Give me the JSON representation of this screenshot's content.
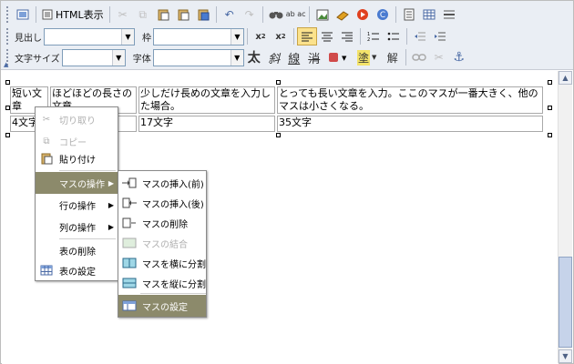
{
  "toolbar": {
    "row1": {
      "html_view_label": "HTML表示",
      "image_label": "ab ac"
    },
    "row2": {
      "heading_label": "見出し",
      "heading_value": "",
      "frame_label": "枠",
      "frame_value": ""
    },
    "row3": {
      "font_size_label": "文字サイズ",
      "font_size_value": "",
      "font_face_label": "字体",
      "font_face_value": "",
      "bold_label": "太",
      "italic_label": "斜",
      "underline_label": "線",
      "strike_label": "消",
      "highlight_label": "塗",
      "clear_label": "解"
    }
  },
  "table": {
    "rows": [
      [
        "短い文章",
        "ほどほどの長さの文章",
        "少しだけ長めの文章を入力した場合。",
        "とっても長い文章を入力。ここのマスが一番大きく、他のマスは小さくなる。"
      ],
      [
        "4文字",
        "",
        "17文字",
        "35文字"
      ]
    ]
  },
  "context_menu": {
    "cut": "切り取り",
    "copy": "コピー",
    "paste": "貼り付け",
    "cell_ops": "マスの操作",
    "row_ops": "行の操作",
    "col_ops": "列の操作",
    "delete_table": "表の削除",
    "table_settings": "表の設定"
  },
  "submenu": {
    "insert_before": "マスの挿入(前)",
    "insert_after": "マスの挿入(後)",
    "delete_cell": "マスの削除",
    "merge_cells": "マスの結合",
    "split_horizontal": "マスを横に分割",
    "split_vertical": "マスを縦に分割",
    "cell_settings": "マスの設定"
  },
  "colors": {
    "toolbar_bg": "#eaeef4",
    "menu_highlight": "#8c8a6b",
    "scroll_thumb": "#c6d3ea"
  }
}
